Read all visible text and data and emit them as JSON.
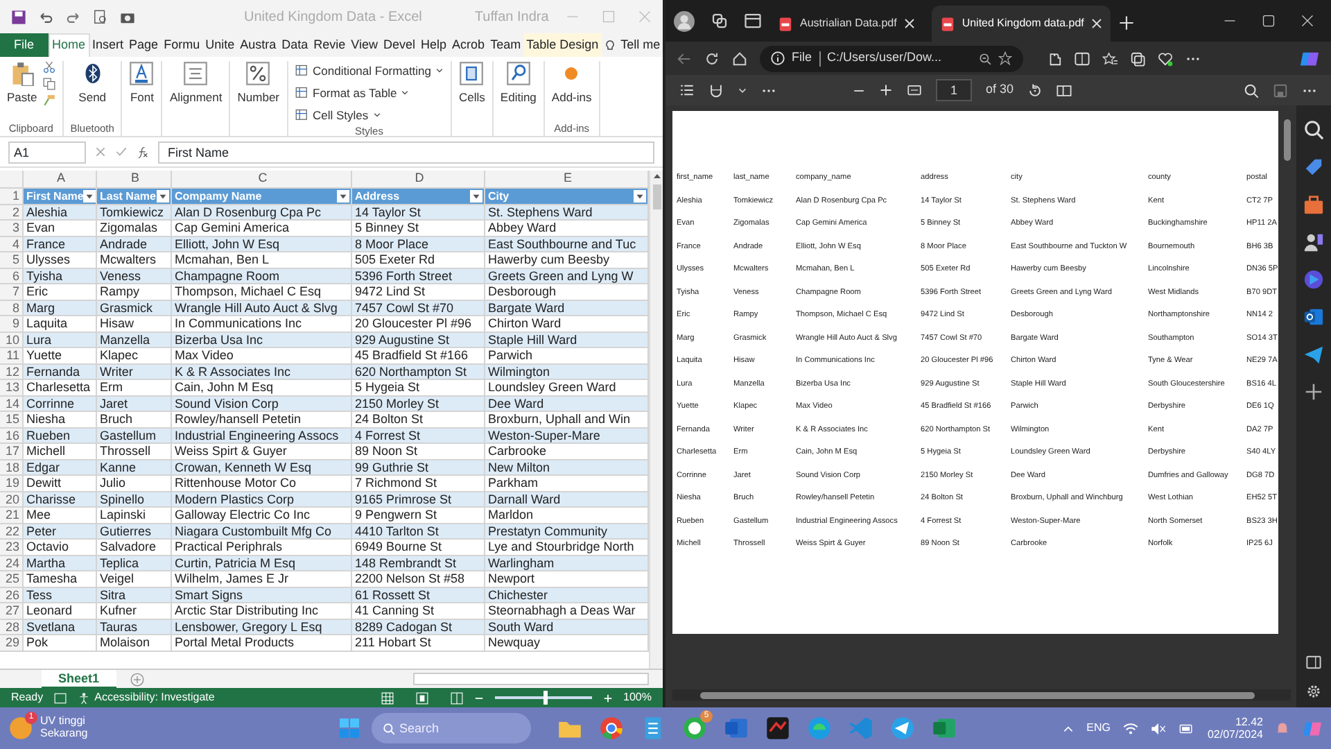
{
  "excel": {
    "title": "United Kingdom Data  -  Excel",
    "user": "Tuffan Indra",
    "ribbon_tabs": [
      {
        "label": "File",
        "kind": "file",
        "selected": false
      },
      {
        "label": "Home",
        "kind": "normal",
        "selected": true
      },
      {
        "label": "Insert",
        "kind": "normal",
        "selected": false
      },
      {
        "label": "Page",
        "kind": "normal",
        "selected": false
      },
      {
        "label": "Formu",
        "kind": "normal",
        "selected": false
      },
      {
        "label": "Unite",
        "kind": "normal",
        "selected": false
      },
      {
        "label": "Austra",
        "kind": "normal",
        "selected": false
      },
      {
        "label": "Data",
        "kind": "normal",
        "selected": false
      },
      {
        "label": "Revie",
        "kind": "normal",
        "selected": false
      },
      {
        "label": "View",
        "kind": "normal",
        "selected": false
      },
      {
        "label": "Devel",
        "kind": "normal",
        "selected": false
      },
      {
        "label": "Help",
        "kind": "normal",
        "selected": false
      },
      {
        "label": "Acrob",
        "kind": "normal",
        "selected": false
      },
      {
        "label": "Team",
        "kind": "normal",
        "selected": false
      },
      {
        "label": "Table Design",
        "kind": "contextual",
        "selected": false
      },
      {
        "label": "Tell me",
        "kind": "search",
        "selected": false
      }
    ],
    "ribbon_groups": [
      {
        "label": "Clipboard",
        "kind": "clipboard",
        "items": [
          "Paste"
        ]
      },
      {
        "label": "Bluetooth",
        "kind": "bluetooth",
        "items": [
          "Send"
        ]
      },
      {
        "kind": "font",
        "items": [
          "Font"
        ]
      },
      {
        "kind": "alignment",
        "items": [
          "Alignment"
        ]
      },
      {
        "kind": "number",
        "items": [
          "Number"
        ]
      },
      {
        "label": "Styles",
        "kind": "styles",
        "items": [
          "Conditional Formatting",
          "Format as Table",
          "Cell Styles"
        ]
      },
      {
        "kind": "cells",
        "items": [
          "Cells"
        ]
      },
      {
        "kind": "editing",
        "items": [
          "Editing"
        ]
      },
      {
        "label": "Add-ins",
        "kind": "addins",
        "items": [
          "Add-ins"
        ]
      }
    ],
    "name_box": "A1",
    "formula": "First Name",
    "columns": [
      "A",
      "B",
      "C",
      "D",
      "E"
    ],
    "header_row": {
      "number": "1",
      "cells": [
        "First Name",
        "Last Name",
        "Compamy Name",
        "Address",
        "City"
      ]
    },
    "rows": [
      {
        "number": "2",
        "cells": [
          "Aleshia",
          "Tomkiewicz",
          "Alan D Rosenburg Cpa Pc",
          "14 Taylor St",
          "St. Stephens Ward"
        ]
      },
      {
        "number": "3",
        "cells": [
          "Evan",
          "Zigomalas",
          "Cap Gemini America",
          "5 Binney St",
          "Abbey Ward"
        ]
      },
      {
        "number": "4",
        "cells": [
          "France",
          "Andrade",
          "Elliott, John W Esq",
          "8 Moor Place",
          "East Southbourne and Tuc"
        ]
      },
      {
        "number": "5",
        "cells": [
          "Ulysses",
          "Mcwalters",
          "Mcmahan, Ben L",
          "505 Exeter Rd",
          "Hawerby cum Beesby"
        ]
      },
      {
        "number": "6",
        "cells": [
          "Tyisha",
          "Veness",
          "Champagne Room",
          "5396 Forth Street",
          "Greets Green and Lyng W"
        ]
      },
      {
        "number": "7",
        "cells": [
          "Eric",
          "Rampy",
          "Thompson, Michael C Esq",
          "9472 Lind St",
          "Desborough"
        ]
      },
      {
        "number": "8",
        "cells": [
          "Marg",
          "Grasmick",
          "Wrangle Hill Auto Auct & Slvg",
          "7457 Cowl St #70",
          "Bargate Ward"
        ]
      },
      {
        "number": "9",
        "cells": [
          "Laquita",
          "Hisaw",
          "In Communications Inc",
          "20 Gloucester Pl #96",
          "Chirton Ward"
        ]
      },
      {
        "number": "10",
        "cells": [
          "Lura",
          "Manzella",
          "Bizerba Usa Inc",
          "929 Augustine St",
          "Staple Hill Ward"
        ]
      },
      {
        "number": "11",
        "cells": [
          "Yuette",
          "Klapec",
          "Max Video",
          "45 Bradfield St #166",
          "Parwich"
        ]
      },
      {
        "number": "12",
        "cells": [
          "Fernanda",
          "Writer",
          "K & R Associates Inc",
          "620 Northampton St",
          "Wilmington"
        ]
      },
      {
        "number": "13",
        "cells": [
          "Charlesetta",
          "Erm",
          "Cain, John M Esq",
          "5 Hygeia St",
          "Loundsley Green Ward"
        ]
      },
      {
        "number": "14",
        "cells": [
          "Corrinne",
          "Jaret",
          "Sound Vision Corp",
          "2150 Morley St",
          "Dee Ward"
        ]
      },
      {
        "number": "15",
        "cells": [
          "Niesha",
          "Bruch",
          "Rowley/hansell Petetin",
          "24 Bolton St",
          "Broxburn, Uphall and Win"
        ]
      },
      {
        "number": "16",
        "cells": [
          "Rueben",
          "Gastellum",
          "Industrial Engineering Assocs",
          "4 Forrest St",
          "Weston-Super-Mare"
        ]
      },
      {
        "number": "17",
        "cells": [
          "Michell",
          "Throssell",
          "Weiss Spirt & Guyer",
          "89 Noon St",
          "Carbrooke"
        ]
      },
      {
        "number": "18",
        "cells": [
          "Edgar",
          "Kanne",
          "Crowan, Kenneth W Esq",
          "99 Guthrie St",
          "New Milton"
        ]
      },
      {
        "number": "19",
        "cells": [
          "Dewitt",
          "Julio",
          "Rittenhouse Motor Co",
          "7 Richmond St",
          "Parkham"
        ]
      },
      {
        "number": "20",
        "cells": [
          "Charisse",
          "Spinello",
          "Modern Plastics Corp",
          "9165 Primrose St",
          "Darnall Ward"
        ]
      },
      {
        "number": "21",
        "cells": [
          "Mee",
          "Lapinski",
          "Galloway Electric Co Inc",
          "9 Pengwern St",
          "Marldon"
        ]
      },
      {
        "number": "22",
        "cells": [
          "Peter",
          "Gutierres",
          "Niagara Custombuilt Mfg Co",
          "4410 Tarlton St",
          "Prestatyn Community"
        ]
      },
      {
        "number": "23",
        "cells": [
          "Octavio",
          "Salvadore",
          "Practical Periphrals",
          "6949 Bourne St",
          "Lye and Stourbridge North"
        ]
      },
      {
        "number": "24",
        "cells": [
          "Martha",
          "Teplica",
          "Curtin, Patricia M Esq",
          "148 Rembrandt St",
          "Warlingham"
        ]
      },
      {
        "number": "25",
        "cells": [
          "Tamesha",
          "Veigel",
          "Wilhelm, James E Jr",
          "2200 Nelson St #58",
          "Newport"
        ]
      },
      {
        "number": "26",
        "cells": [
          "Tess",
          "Sitra",
          "Smart Signs",
          "61 Rossett St",
          "Chichester"
        ]
      },
      {
        "number": "27",
        "cells": [
          "Leonard",
          "Kufner",
          "Arctic Star Distributing Inc",
          "41 Canning St",
          "Steornabhagh a Deas War"
        ]
      },
      {
        "number": "28",
        "cells": [
          "Svetlana",
          "Tauras",
          "Lensbower, Gregory L Esq",
          "8289 Cadogan St",
          "South Ward"
        ]
      },
      {
        "number": "29",
        "cells": [
          "Pok",
          "Molaison",
          "Portal Metal Products",
          "211 Hobart St",
          "Newquay"
        ]
      }
    ],
    "sheet_tabs": [
      {
        "label": "Sheet1",
        "selected": true
      }
    ],
    "status": "Ready",
    "accessibility": "Accessibility: Investigate",
    "zoom_slider": {
      "level": 0.5
    },
    "zoom": "100%"
  },
  "edge": {
    "tabs": [
      {
        "label": "Austrialian Data.pdf",
        "selected": false
      },
      {
        "label": "United Kingdom data.pdf",
        "selected": true
      }
    ],
    "address": {
      "scheme": "File",
      "path": "C:/Users/user/Dow..."
    },
    "pdf_toolbar": {
      "page": "1",
      "page_count": "of 30"
    },
    "pdf_table": {
      "columns": [
        "first_name",
        "last_name",
        "company_name",
        "address",
        "city",
        "county",
        "postal"
      ],
      "rows": [
        [
          "Aleshia",
          "Tomkiewicz",
          "Alan D Rosenburg Cpa Pc",
          "14 Taylor St",
          "St. Stephens Ward",
          "Kent",
          "CT2 7P"
        ],
        [
          "Evan",
          "Zigomalas",
          "Cap Gemini America",
          "5 Binney St",
          "Abbey Ward",
          "Buckinghamshire",
          "HP11 2A"
        ],
        [
          "France",
          "Andrade",
          "Elliott, John W Esq",
          "8 Moor Place",
          "East Southbourne and Tuckton W",
          "Bournemouth",
          "BH6 3B"
        ],
        [
          "Ulysses",
          "Mcwalters",
          "Mcmahan, Ben L",
          "505 Exeter Rd",
          "Hawerby cum Beesby",
          "Lincolnshire",
          "DN36 5P"
        ],
        [
          "Tyisha",
          "Veness",
          "Champagne Room",
          "5396 Forth Street",
          "Greets Green and Lyng Ward",
          "West Midlands",
          "B70 9DT"
        ],
        [
          "Eric",
          "Rampy",
          "Thompson, Michael C Esq",
          "9472 Lind St",
          "Desborough",
          "Northamptonshire",
          "NN14 2"
        ],
        [
          "Marg",
          "Grasmick",
          "Wrangle Hill Auto Auct & Slvg",
          "7457 Cowl St #70",
          "Bargate Ward",
          "Southampton",
          "SO14 3T"
        ],
        [
          "Laquita",
          "Hisaw",
          "In Communications Inc",
          "20 Gloucester Pl #96",
          "Chirton Ward",
          "Tyne & Wear",
          "NE29 7A"
        ],
        [
          "Lura",
          "Manzella",
          "Bizerba Usa Inc",
          "929 Augustine St",
          "Staple Hill Ward",
          "South Gloucestershire",
          "BS16 4L"
        ],
        [
          "Yuette",
          "Klapec",
          "Max Video",
          "45 Bradfield St #166",
          "Parwich",
          "Derbyshire",
          "DE6 1Q"
        ],
        [
          "Fernanda",
          "Writer",
          "K & R Associates Inc",
          "620 Northampton St",
          "Wilmington",
          "Kent",
          "DA2 7P"
        ],
        [
          "Charlesetta",
          "Erm",
          "Cain, John M Esq",
          "5 Hygeia St",
          "Loundsley Green Ward",
          "Derbyshire",
          "S40 4LY"
        ],
        [
          "Corrinne",
          "Jaret",
          "Sound Vision Corp",
          "2150 Morley St",
          "Dee Ward",
          "Dumfries and Galloway",
          "DG8 7D"
        ],
        [
          "Niesha",
          "Bruch",
          "Rowley/hansell Petetin",
          "24 Bolton St",
          "Broxburn, Uphall and Winchburg",
          "West Lothian",
          "EH52 5T"
        ],
        [
          "Rueben",
          "Gastellum",
          "Industrial Engineering Assocs",
          "4 Forrest St",
          "Weston-Super-Mare",
          "North Somerset",
          "BS23 3H"
        ],
        [
          "Michell",
          "Throssell",
          "Weiss Spirt & Guyer",
          "89 Noon St",
          "Carbrooke",
          "Norfolk",
          "IP25 6J"
        ]
      ]
    }
  },
  "taskbar": {
    "weather": {
      "title": "UV tinggi",
      "subtitle": "Sekarang",
      "badge": "1"
    },
    "search": {
      "placeholder": "Search"
    },
    "apps": [
      {
        "kind": "folder"
      },
      {
        "kind": "chrome"
      },
      {
        "kind": "notepad"
      },
      {
        "kind": "chat",
        "badge": "5"
      },
      {
        "kind": "word"
      },
      {
        "kind": "game"
      },
      {
        "kind": "edge"
      },
      {
        "kind": "vscode"
      },
      {
        "kind": "telegram"
      },
      {
        "kind": "excel"
      }
    ],
    "language": "ENG",
    "time": "12.42",
    "date": "02/07/2024"
  }
}
